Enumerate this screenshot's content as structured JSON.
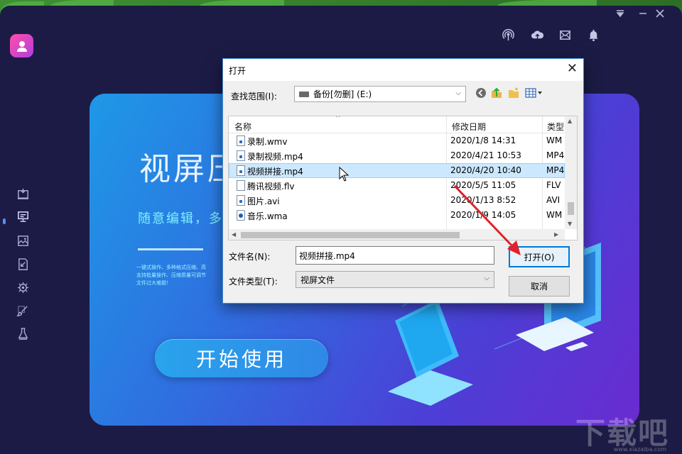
{
  "app": {
    "hero_title": "视屏压",
    "hero_subtitle": "随意编辑，多格",
    "hero_desc": "一键式操作、多种格式压缩、高\n支持批量操作、压缩质量可调节\n文件过大难题！",
    "start_button": "开始使用",
    "icons": {
      "window_min": "chevron-down-icon",
      "window_close": "close-icon",
      "top": [
        "broadcast-icon",
        "cloud-upload-icon",
        "mail-icon",
        "bell-icon"
      ],
      "sidebar": [
        "monitor-compress-icon",
        "screen-record-icon",
        "image-icon",
        "document-icon",
        "gear-brain-icon",
        "brush-icon",
        "flask-icon"
      ]
    }
  },
  "dialog": {
    "title": "打开",
    "close": "✕",
    "look_in_label": "查找范围(I):",
    "look_in_value": "备份[勿删] (E:)",
    "columns": {
      "name": "名称",
      "date": "修改日期",
      "type": "类型"
    },
    "files": [
      {
        "name": "录制.wmv",
        "date": "2020/1/8 14:31",
        "type": "WM"
      },
      {
        "name": "录制视频.mp4",
        "date": "2020/4/21 10:53",
        "type": "MP4"
      },
      {
        "name": "视频拼接.mp4",
        "date": "2020/4/20 10:40",
        "type": "MP4"
      },
      {
        "name": "腾讯视频.flv",
        "date": "2020/5/5 11:05",
        "type": "FLV"
      },
      {
        "name": "图片.avi",
        "date": "2020/1/13 8:52",
        "type": "AVI"
      },
      {
        "name": "音乐.wma",
        "date": "2020/1/9 14:05",
        "type": "WM"
      }
    ],
    "filename_label": "文件名(N):",
    "filename_value": "视频拼接.mp4",
    "filetype_label": "文件类型(T):",
    "filetype_value": "视屏文件",
    "open_button": "打开(O)",
    "cancel_button": "取消"
  },
  "watermark": {
    "text": "下载吧",
    "sub": "www.xiazaiba.com"
  }
}
